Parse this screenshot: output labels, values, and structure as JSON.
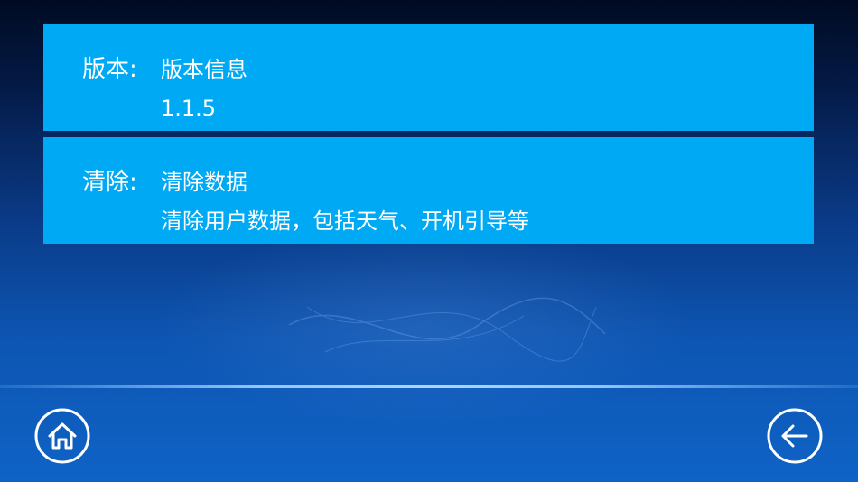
{
  "version_card": {
    "label": "版本:",
    "title": "版本信息",
    "value": "1.1.5"
  },
  "clear_card": {
    "label": "清除:",
    "title": "清除数据",
    "value": "清除用户数据，包括天气、开机引导等"
  },
  "nav": {
    "home_icon": "home-icon",
    "back_icon": "arrow-left-icon"
  },
  "colors": {
    "card_background": "#00a9f4",
    "text": "#ffffff",
    "background_top": "#000b22",
    "background_bottom": "#0f63c6"
  }
}
